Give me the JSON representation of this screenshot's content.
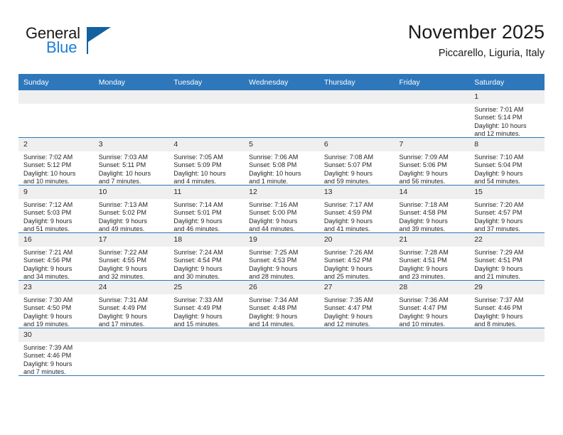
{
  "brand": {
    "name_part1": "General",
    "name_part2": "Blue",
    "logo_icon": "triangle-flag-icon",
    "accent_color": "#1b7fd4",
    "dark_color": "#14619e"
  },
  "header": {
    "title": "November 2025",
    "subtitle": "Piccarello, Liguria, Italy"
  },
  "calendar": {
    "header_bg": "#2e77bb",
    "daynum_bg": "#efefef",
    "weekday_headers": [
      "Sunday",
      "Monday",
      "Tuesday",
      "Wednesday",
      "Thursday",
      "Friday",
      "Saturday"
    ],
    "weeks": [
      [
        {
          "day": "",
          "empty": true
        },
        {
          "day": "",
          "empty": true
        },
        {
          "day": "",
          "empty": true
        },
        {
          "day": "",
          "empty": true
        },
        {
          "day": "",
          "empty": true
        },
        {
          "day": "",
          "empty": true
        },
        {
          "day": "1",
          "sunrise": "Sunrise: 7:01 AM",
          "sunset": "Sunset: 5:14 PM",
          "daylight_line1": "Daylight: 10 hours",
          "daylight_line2": "and 12 minutes."
        }
      ],
      [
        {
          "day": "2",
          "sunrise": "Sunrise: 7:02 AM",
          "sunset": "Sunset: 5:12 PM",
          "daylight_line1": "Daylight: 10 hours",
          "daylight_line2": "and 10 minutes."
        },
        {
          "day": "3",
          "sunrise": "Sunrise: 7:03 AM",
          "sunset": "Sunset: 5:11 PM",
          "daylight_line1": "Daylight: 10 hours",
          "daylight_line2": "and 7 minutes."
        },
        {
          "day": "4",
          "sunrise": "Sunrise: 7:05 AM",
          "sunset": "Sunset: 5:09 PM",
          "daylight_line1": "Daylight: 10 hours",
          "daylight_line2": "and 4 minutes."
        },
        {
          "day": "5",
          "sunrise": "Sunrise: 7:06 AM",
          "sunset": "Sunset: 5:08 PM",
          "daylight_line1": "Daylight: 10 hours",
          "daylight_line2": "and 1 minute."
        },
        {
          "day": "6",
          "sunrise": "Sunrise: 7:08 AM",
          "sunset": "Sunset: 5:07 PM",
          "daylight_line1": "Daylight: 9 hours",
          "daylight_line2": "and 59 minutes."
        },
        {
          "day": "7",
          "sunrise": "Sunrise: 7:09 AM",
          "sunset": "Sunset: 5:06 PM",
          "daylight_line1": "Daylight: 9 hours",
          "daylight_line2": "and 56 minutes."
        },
        {
          "day": "8",
          "sunrise": "Sunrise: 7:10 AM",
          "sunset": "Sunset: 5:04 PM",
          "daylight_line1": "Daylight: 9 hours",
          "daylight_line2": "and 54 minutes."
        }
      ],
      [
        {
          "day": "9",
          "sunrise": "Sunrise: 7:12 AM",
          "sunset": "Sunset: 5:03 PM",
          "daylight_line1": "Daylight: 9 hours",
          "daylight_line2": "and 51 minutes."
        },
        {
          "day": "10",
          "sunrise": "Sunrise: 7:13 AM",
          "sunset": "Sunset: 5:02 PM",
          "daylight_line1": "Daylight: 9 hours",
          "daylight_line2": "and 49 minutes."
        },
        {
          "day": "11",
          "sunrise": "Sunrise: 7:14 AM",
          "sunset": "Sunset: 5:01 PM",
          "daylight_line1": "Daylight: 9 hours",
          "daylight_line2": "and 46 minutes."
        },
        {
          "day": "12",
          "sunrise": "Sunrise: 7:16 AM",
          "sunset": "Sunset: 5:00 PM",
          "daylight_line1": "Daylight: 9 hours",
          "daylight_line2": "and 44 minutes."
        },
        {
          "day": "13",
          "sunrise": "Sunrise: 7:17 AM",
          "sunset": "Sunset: 4:59 PM",
          "daylight_line1": "Daylight: 9 hours",
          "daylight_line2": "and 41 minutes."
        },
        {
          "day": "14",
          "sunrise": "Sunrise: 7:18 AM",
          "sunset": "Sunset: 4:58 PM",
          "daylight_line1": "Daylight: 9 hours",
          "daylight_line2": "and 39 minutes."
        },
        {
          "day": "15",
          "sunrise": "Sunrise: 7:20 AM",
          "sunset": "Sunset: 4:57 PM",
          "daylight_line1": "Daylight: 9 hours",
          "daylight_line2": "and 37 minutes."
        }
      ],
      [
        {
          "day": "16",
          "sunrise": "Sunrise: 7:21 AM",
          "sunset": "Sunset: 4:56 PM",
          "daylight_line1": "Daylight: 9 hours",
          "daylight_line2": "and 34 minutes."
        },
        {
          "day": "17",
          "sunrise": "Sunrise: 7:22 AM",
          "sunset": "Sunset: 4:55 PM",
          "daylight_line1": "Daylight: 9 hours",
          "daylight_line2": "and 32 minutes."
        },
        {
          "day": "18",
          "sunrise": "Sunrise: 7:24 AM",
          "sunset": "Sunset: 4:54 PM",
          "daylight_line1": "Daylight: 9 hours",
          "daylight_line2": "and 30 minutes."
        },
        {
          "day": "19",
          "sunrise": "Sunrise: 7:25 AM",
          "sunset": "Sunset: 4:53 PM",
          "daylight_line1": "Daylight: 9 hours",
          "daylight_line2": "and 28 minutes."
        },
        {
          "day": "20",
          "sunrise": "Sunrise: 7:26 AM",
          "sunset": "Sunset: 4:52 PM",
          "daylight_line1": "Daylight: 9 hours",
          "daylight_line2": "and 25 minutes."
        },
        {
          "day": "21",
          "sunrise": "Sunrise: 7:28 AM",
          "sunset": "Sunset: 4:51 PM",
          "daylight_line1": "Daylight: 9 hours",
          "daylight_line2": "and 23 minutes."
        },
        {
          "day": "22",
          "sunrise": "Sunrise: 7:29 AM",
          "sunset": "Sunset: 4:51 PM",
          "daylight_line1": "Daylight: 9 hours",
          "daylight_line2": "and 21 minutes."
        }
      ],
      [
        {
          "day": "23",
          "sunrise": "Sunrise: 7:30 AM",
          "sunset": "Sunset: 4:50 PM",
          "daylight_line1": "Daylight: 9 hours",
          "daylight_line2": "and 19 minutes."
        },
        {
          "day": "24",
          "sunrise": "Sunrise: 7:31 AM",
          "sunset": "Sunset: 4:49 PM",
          "daylight_line1": "Daylight: 9 hours",
          "daylight_line2": "and 17 minutes."
        },
        {
          "day": "25",
          "sunrise": "Sunrise: 7:33 AM",
          "sunset": "Sunset: 4:49 PM",
          "daylight_line1": "Daylight: 9 hours",
          "daylight_line2": "and 15 minutes."
        },
        {
          "day": "26",
          "sunrise": "Sunrise: 7:34 AM",
          "sunset": "Sunset: 4:48 PM",
          "daylight_line1": "Daylight: 9 hours",
          "daylight_line2": "and 14 minutes."
        },
        {
          "day": "27",
          "sunrise": "Sunrise: 7:35 AM",
          "sunset": "Sunset: 4:47 PM",
          "daylight_line1": "Daylight: 9 hours",
          "daylight_line2": "and 12 minutes."
        },
        {
          "day": "28",
          "sunrise": "Sunrise: 7:36 AM",
          "sunset": "Sunset: 4:47 PM",
          "daylight_line1": "Daylight: 9 hours",
          "daylight_line2": "and 10 minutes."
        },
        {
          "day": "29",
          "sunrise": "Sunrise: 7:37 AM",
          "sunset": "Sunset: 4:46 PM",
          "daylight_line1": "Daylight: 9 hours",
          "daylight_line2": "and 8 minutes."
        }
      ],
      [
        {
          "day": "30",
          "sunrise": "Sunrise: 7:39 AM",
          "sunset": "Sunset: 4:46 PM",
          "daylight_line1": "Daylight: 9 hours",
          "daylight_line2": "and 7 minutes."
        },
        {
          "day": "",
          "empty": true
        },
        {
          "day": "",
          "empty": true
        },
        {
          "day": "",
          "empty": true
        },
        {
          "day": "",
          "empty": true
        },
        {
          "day": "",
          "empty": true
        },
        {
          "day": "",
          "empty": true
        }
      ]
    ]
  }
}
